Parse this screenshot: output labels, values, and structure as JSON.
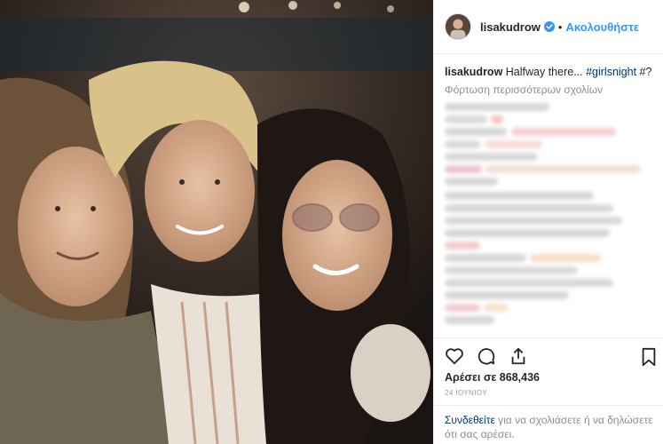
{
  "post": {
    "username": "lisakudrow",
    "follow_label": "Ακολουθήστε",
    "separator": "•",
    "caption_user": "lisakudrow",
    "caption_text": " Halfway there... ",
    "caption_tag": "#girlsnight",
    "caption_tail": " #?",
    "load_more": "Φόρτωση περισσότερων σχολίων",
    "likes": "Αρέσει σε 868,436",
    "date": "24 ΙΟΥΝΙΟΥ",
    "login_link": "Συνδεθείτε",
    "login_text": " για να σχολιάσετε ή να δηλώσετε ότι σας αρέσει."
  },
  "icons": {
    "verified": "verified-badge-icon",
    "like": "heart-icon",
    "comment": "comment-bubble-icon",
    "share": "share-icon",
    "save": "bookmark-icon"
  },
  "colors": {
    "link_blue": "#3897f0",
    "hashtag": "#003569",
    "muted": "#8e8e8e",
    "border": "#efefef"
  }
}
